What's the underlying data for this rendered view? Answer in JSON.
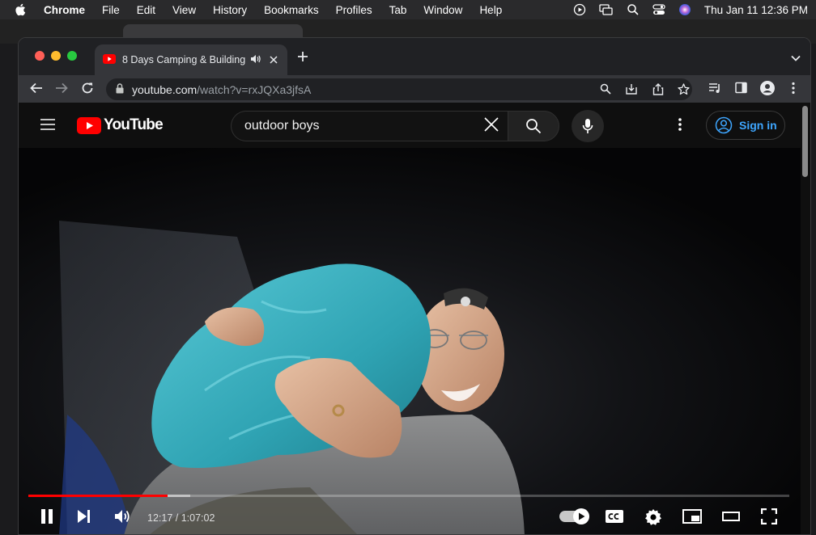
{
  "menubar": {
    "app_name": "Chrome",
    "items": [
      "File",
      "Edit",
      "View",
      "History",
      "Bookmarks",
      "Profiles",
      "Tab",
      "Window",
      "Help"
    ],
    "clock": "Thu Jan 11  12:36 PM"
  },
  "browser": {
    "tab_title": "8 Days Camping & Building",
    "url_host": "youtube.com",
    "url_path": "/watch?v=rxJQXa3jfsA"
  },
  "youtube": {
    "logo_text": "YouTube",
    "search_query": "outdoor boys",
    "signin_label": "Sign in"
  },
  "player": {
    "time_current": "12:17",
    "time_separator": " / ",
    "time_total": "1:07:02",
    "progress_fraction": 0.183,
    "buffered_fraction": 0.213,
    "autoplay_on": true
  },
  "colors": {
    "progress_played": "#ff0000",
    "youtube_red": "#ff0000",
    "signin_blue": "#3ea6ff"
  }
}
